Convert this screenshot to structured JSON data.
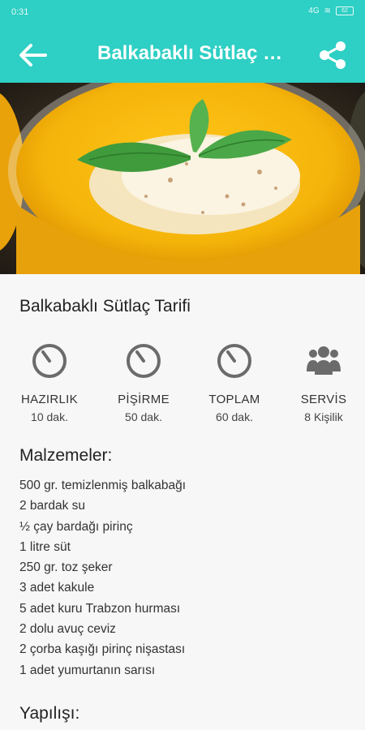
{
  "status_bar": {
    "time": "0:31",
    "signal": "4G",
    "battery": "62"
  },
  "app_bar": {
    "title": "Balkabaklı Sütlaç Tarifi",
    "back_icon": "arrow-left-icon",
    "share_icon": "share-icon"
  },
  "colors": {
    "primary": "#2ecfc4",
    "pudding": "#f5b40a",
    "mint": "#3f9b3c"
  },
  "recipe": {
    "title": "Balkabaklı Sütlaç Tarifi",
    "stats": [
      {
        "label": "HAZIRLIK",
        "value": "10 dak.",
        "icon": "timer-icon"
      },
      {
        "label": "PİŞİRME",
        "value": "50 dak.",
        "icon": "timer-icon"
      },
      {
        "label": "TOPLAM",
        "value": "60 dak.",
        "icon": "timer-icon"
      },
      {
        "label": "SERVİS",
        "value": "8 Kişilik",
        "icon": "people-icon"
      }
    ],
    "ingredients_title": "Malzemeler:",
    "ingredients": [
      "500 gr. temizlenmiş balkabağı",
      "2 bardak su",
      "½ çay bardağı pirinç",
      "1 litre süt",
      "250 gr. toz şeker",
      "3 adet kakule",
      "5 adet kuru Trabzon hurması",
      "2 dolu avuç ceviz",
      "2 çorba kaşığı pirinç nişastası",
      "1 adet yumurtanın sarısı"
    ],
    "directions_title": "Yapılışı:"
  }
}
